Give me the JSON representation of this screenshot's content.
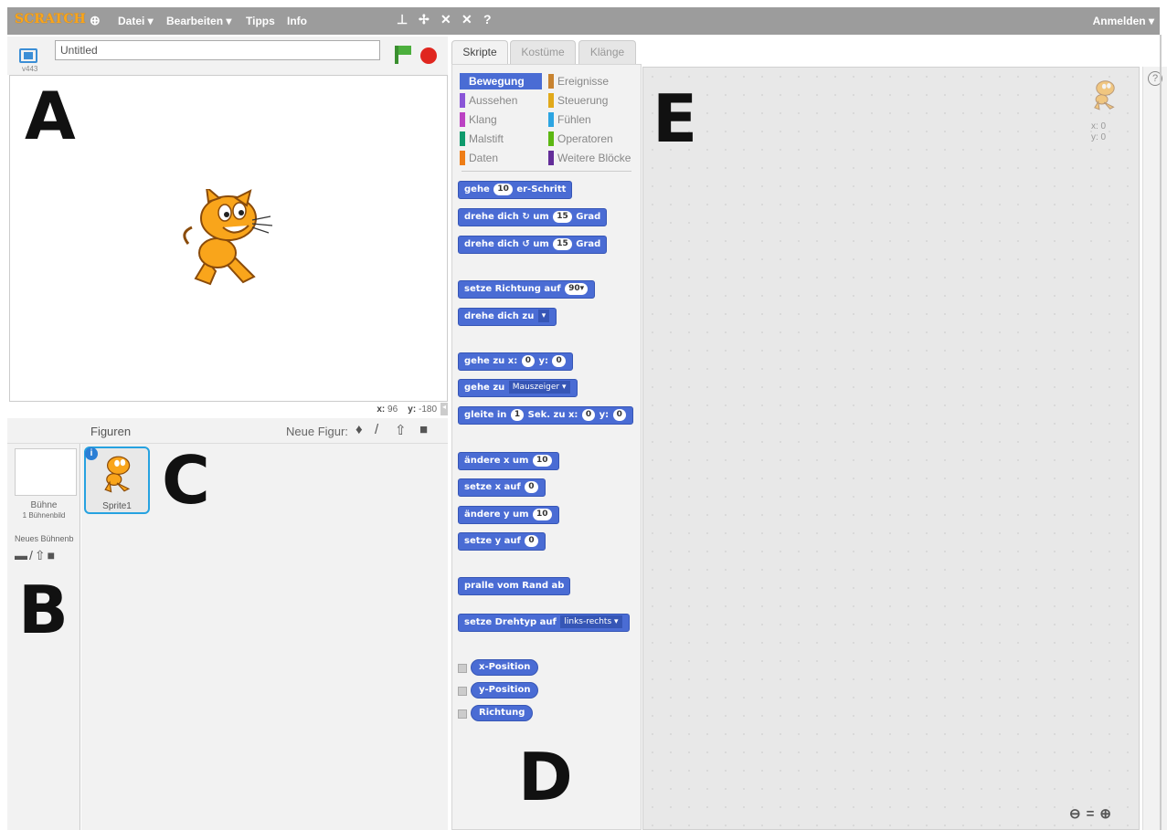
{
  "menubar": {
    "logo": "SCRATCH",
    "globe_icon": "globe-icon",
    "items": [
      "Datei ▾",
      "Bearbeiten ▾",
      "Tipps",
      "Info"
    ],
    "tool_icons": [
      "duplicate-stamp-icon",
      "delete-cut-icon",
      "grow-icon",
      "shrink-icon",
      "help-icon"
    ],
    "login": "Anmelden ▾"
  },
  "stage_header": {
    "version": "v443",
    "title_value": "Untitled",
    "fullscreen_icon": "fullscreen-icon",
    "flag_icon": "green-flag-icon",
    "stop_icon": "stop-icon"
  },
  "stage": {
    "sprite_icon": "scratch-cat-sprite",
    "coords_x_label": "x:",
    "coords_x": "96",
    "coords_y_label": "y:",
    "coords_y": "-180"
  },
  "sprite_pane": {
    "title": "Figuren",
    "new_sprite_label": "Neue Figur:",
    "new_sprite_icons": [
      "library-icon",
      "paint-icon",
      "upload-icon",
      "camera-icon"
    ],
    "stage_label": "Bühne",
    "stage_backdrops": "1 Bühnenbild",
    "new_backdrop_label": "Neues Bühnenb",
    "sprites": [
      {
        "name": "Sprite1"
      }
    ]
  },
  "tabs": [
    "Skripte",
    "Kostüme",
    "Klänge"
  ],
  "categories": [
    {
      "label": "Bewegung",
      "color": "#4a6cd4"
    },
    {
      "label": "Ereignisse",
      "color": "#c88330"
    },
    {
      "label": "Aussehen",
      "color": "#8a55d7"
    },
    {
      "label": "Steuerung",
      "color": "#e1a91a"
    },
    {
      "label": "Klang",
      "color": "#bb42c3"
    },
    {
      "label": "Fühlen",
      "color": "#2ca5e2"
    },
    {
      "label": "Malstift",
      "color": "#0e9a6c"
    },
    {
      "label": "Operatoren",
      "color": "#5cb712"
    },
    {
      "label": "Daten",
      "color": "#ee7d16"
    },
    {
      "label": "Weitere Blöcke",
      "color": "#632d99"
    }
  ],
  "blocks": {
    "b1": {
      "a": "gehe",
      "n1": "10",
      "b": "er-Schritt"
    },
    "b2": {
      "a": "drehe dich",
      "icon": "↻",
      "b": "um",
      "n1": "15",
      "c": "Grad"
    },
    "b3": {
      "a": "drehe dich",
      "icon": "↺",
      "b": "um",
      "n1": "15",
      "c": "Grad"
    },
    "b4": {
      "a": "setze Richtung auf",
      "n1": "90▾"
    },
    "b5": {
      "a": "drehe dich zu",
      "dd": "▾"
    },
    "b6": {
      "a": "gehe zu x:",
      "n1": "0",
      "b": "y:",
      "n2": "0"
    },
    "b7": {
      "a": "gehe zu",
      "dd": "Mauszeiger ▾"
    },
    "b8": {
      "a": "gleite in",
      "n1": "1",
      "b": "Sek. zu x:",
      "n2": "0",
      "c": "y:",
      "n3": "0"
    },
    "b9": {
      "a": "ändere x um",
      "n1": "10"
    },
    "b10": {
      "a": "setze x auf",
      "n1": "0"
    },
    "b11": {
      "a": "ändere y um",
      "n1": "10"
    },
    "b12": {
      "a": "setze y auf",
      "n1": "0"
    },
    "b13": {
      "a": "pralle vom Rand ab"
    },
    "b14": {
      "a": "setze Drehtyp auf",
      "dd": "links-rechts ▾"
    },
    "r1": "x-Position",
    "r2": "y-Position",
    "r3": "Richtung"
  },
  "scripts_area": {
    "sprite_x": "x: 0",
    "sprite_y": "y: 0",
    "zoom_icons": [
      "zoom-out-icon",
      "zoom-reset-icon",
      "zoom-in-icon"
    ],
    "help": "?"
  },
  "annotations": {
    "A": "A",
    "B": "B",
    "C": "C",
    "D": "D",
    "E": "E"
  }
}
